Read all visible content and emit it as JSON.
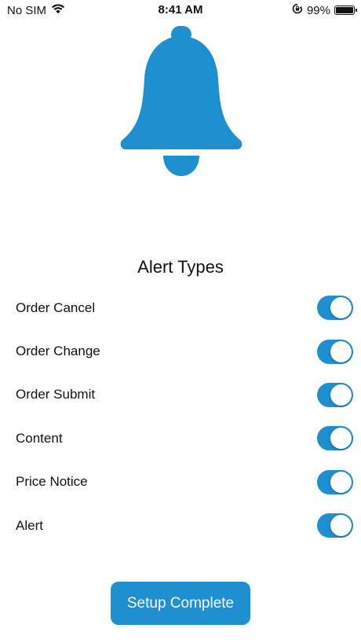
{
  "status_bar": {
    "carrier": "No SIM",
    "time": "8:41 AM",
    "battery": "99%",
    "battery_level": 0.99,
    "icons": [
      "wifi-icon",
      "orientation-lock-icon",
      "battery-icon"
    ]
  },
  "hero": {
    "icon": "bell-icon",
    "color": "#1e8fcf"
  },
  "alert_types": {
    "title": "Alert Types",
    "items": [
      {
        "label": "Order Cancel",
        "enabled": true
      },
      {
        "label": "Order Change",
        "enabled": true
      },
      {
        "label": "Order Submit",
        "enabled": true
      },
      {
        "label": "Content",
        "enabled": true
      },
      {
        "label": "Price Notice",
        "enabled": true
      },
      {
        "label": "Alert",
        "enabled": true
      }
    ]
  },
  "actions": {
    "setup_complete_label": "Setup Complete"
  },
  "colors": {
    "accent": "#1e8fcf",
    "background": "#ffffff",
    "text": "#111111"
  }
}
